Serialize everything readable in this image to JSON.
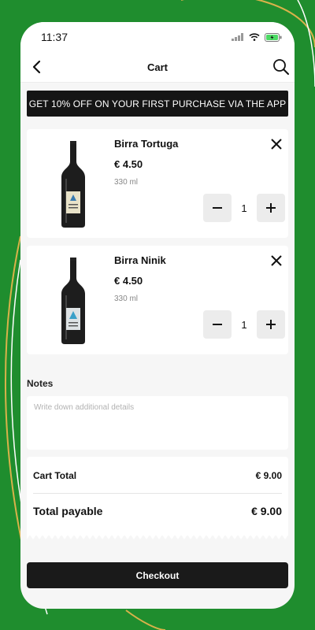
{
  "status_bar": {
    "time": "11:37"
  },
  "header": {
    "title": "Cart"
  },
  "promo": {
    "text": "GET 10% OFF ON YOUR FIRST PURCHASE VIA THE APP"
  },
  "items": [
    {
      "name": "Birra Tortuga",
      "price": "€ 4.50",
      "volume": "330 ml",
      "quantity": "1",
      "label_color": "#e8e2c8"
    },
    {
      "name": "Birra Ninik",
      "price": "€ 4.50",
      "volume": "330 ml",
      "quantity": "1",
      "label_color": "#dde2e4"
    }
  ],
  "notes": {
    "label": "Notes",
    "placeholder": "Write down additional details"
  },
  "summary": {
    "cart_total_label": "Cart Total",
    "cart_total_value": "€ 9.00",
    "payable_label": "Total payable",
    "payable_value": "€ 9.00"
  },
  "checkout": {
    "label": "Checkout"
  },
  "colors": {
    "background": "#1f8d2e",
    "accent_line": "#d9b24a",
    "dark": "#151515"
  },
  "icons": [
    "back-arrow-icon",
    "search-icon",
    "close-icon",
    "minus-icon",
    "plus-icon",
    "signal-icon",
    "wifi-icon",
    "battery-icon"
  ]
}
